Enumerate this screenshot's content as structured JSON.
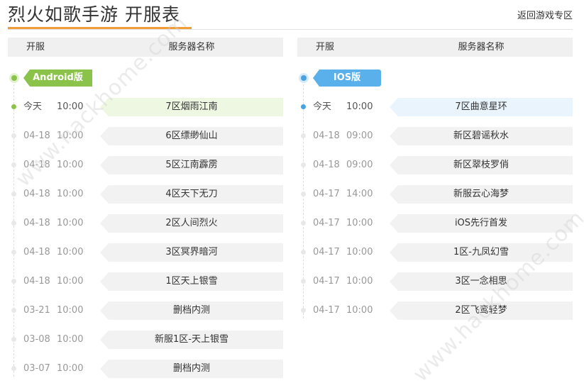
{
  "header": {
    "title": "烈火如歌手游 开服表",
    "back_link": "返回游戏专区"
  },
  "table_header": {
    "col_date": "开服",
    "col_server": "服务器名称"
  },
  "watermark": "www.hackhome.com",
  "colors": {
    "accent_orange": "#f29c38",
    "android_green": "#8bc34a",
    "ios_blue": "#5ab0ea"
  },
  "android": {
    "tag": "Android版",
    "entries": [
      {
        "date": "今天",
        "time": "10:00",
        "server": "7区烟雨江南"
      },
      {
        "date": "04-18",
        "time": "10:00",
        "server": "6区缥缈仙山"
      },
      {
        "date": "04-18",
        "time": "10:00",
        "server": "5区江南霹雳"
      },
      {
        "date": "04-18",
        "time": "10:00",
        "server": "4区天下无刀"
      },
      {
        "date": "04-18",
        "time": "10:00",
        "server": "2区人间烈火"
      },
      {
        "date": "04-18",
        "time": "10:00",
        "server": "3区冥界暗河"
      },
      {
        "date": "04-18",
        "time": "10:00",
        "server": "1区天上银雪"
      },
      {
        "date": "03-21",
        "time": "10:00",
        "server": "删档内测"
      },
      {
        "date": "03-08",
        "time": "10:00",
        "server": "新服1区-天上银雪"
      },
      {
        "date": "03-07",
        "time": "10:00",
        "server": "删档内测"
      }
    ]
  },
  "ios": {
    "tag": "IOS版",
    "entries": [
      {
        "date": "今天",
        "time": "10:00",
        "server": "7区曲意星环"
      },
      {
        "date": "04-18",
        "time": "09:00",
        "server": "新区碧谣秋水"
      },
      {
        "date": "04-18",
        "time": "09:00",
        "server": "新区翠枝罗俏"
      },
      {
        "date": "04-17",
        "time": "14:00",
        "server": "新服云心海梦"
      },
      {
        "date": "04-17",
        "time": "10:00",
        "server": "iOS先行首发"
      },
      {
        "date": "04-17",
        "time": "10:00",
        "server": "1区-九凤幻雪"
      },
      {
        "date": "04-17",
        "time": "10:00",
        "server": "3区一念相思"
      },
      {
        "date": "04-17",
        "time": "10:00",
        "server": "2区飞鸾轻梦"
      }
    ]
  }
}
